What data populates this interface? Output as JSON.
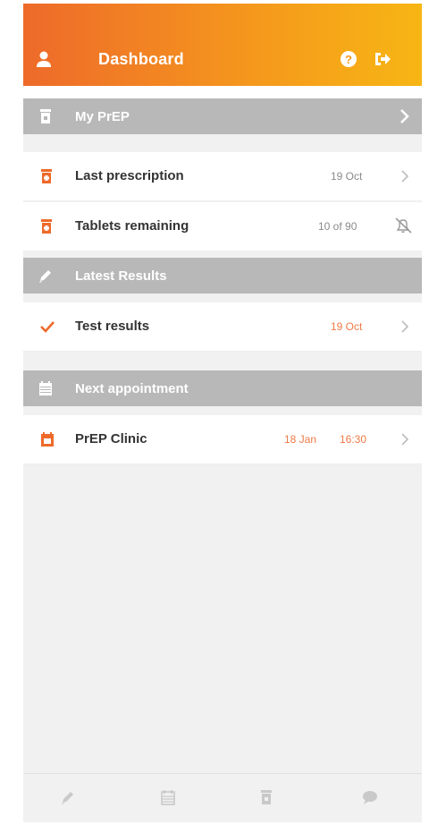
{
  "header": {
    "title": "Dashboard"
  },
  "sections": {
    "my_prep": "My PrEP",
    "latest_results": "Latest Results",
    "next_appointment": "Next appointment"
  },
  "rows": {
    "last_prescription": {
      "label": "Last prescription",
      "value": "19 Oct"
    },
    "tablets_remaining": {
      "label": "Tablets remaining",
      "value": "10 of 90"
    },
    "test_results": {
      "label": "Test results",
      "value": "19 Oct"
    },
    "clinic": {
      "label": "PrEP Clinic",
      "date": "18 Jan",
      "time": "16:30"
    }
  },
  "colors": {
    "accent": "#ee6a2a",
    "header_gradient_end": "#f7b614",
    "section_bg": "#b8b8b8",
    "accent_text": "#ef7a46"
  },
  "icons": {
    "header": [
      "user-icon",
      "help-icon",
      "logout-icon"
    ],
    "sections": [
      "pill-bottle-icon",
      "pen-icon",
      "calendar-icon"
    ],
    "bottom_nav": [
      "pen-icon",
      "calendar-icon",
      "pill-bottle-icon",
      "chat-icon"
    ]
  }
}
